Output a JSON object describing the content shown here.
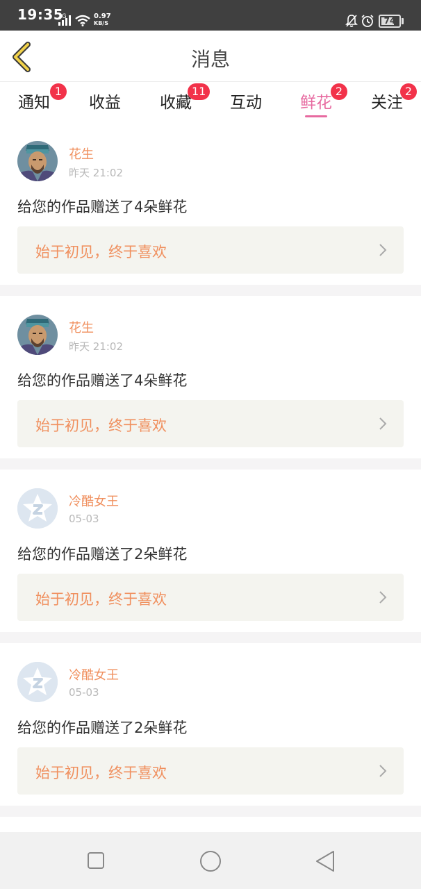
{
  "status_bar": {
    "time": "19:35",
    "network": "2G",
    "speed_value": "0.97",
    "speed_unit": "KB/S",
    "battery": "74",
    "battery_level": 0.74
  },
  "header": {
    "title": "消息",
    "back_icon": "chevron-left-icon"
  },
  "tabs": [
    {
      "label": "通知",
      "badge": "1",
      "active": false
    },
    {
      "label": "收益",
      "badge": "",
      "active": false
    },
    {
      "label": "收藏",
      "badge": "11",
      "active": false
    },
    {
      "label": "互动",
      "badge": "",
      "active": false
    },
    {
      "label": "鲜花",
      "badge": "2",
      "active": true
    },
    {
      "label": "关注",
      "badge": "2",
      "active": false
    }
  ],
  "messages": [
    {
      "user": "花生",
      "time": "昨天 21:02",
      "text": "给您的作品赠送了4朵鲜花",
      "quote": "始于初见，终于喜欢",
      "avatar": "portrait"
    },
    {
      "user": "花生",
      "time": "昨天 21:02",
      "text": "给您的作品赠送了4朵鲜花",
      "quote": "始于初见，终于喜欢",
      "avatar": "portrait"
    },
    {
      "user": "冷酷女王",
      "time": "05-03",
      "text": "给您的作品赠送了2朵鲜花",
      "quote": "始于初见，终于喜欢",
      "avatar": "default"
    },
    {
      "user": "冷酷女王",
      "time": "05-03",
      "text": "给您的作品赠送了2朵鲜花",
      "quote": "始于初见，终于喜欢",
      "avatar": "default"
    }
  ],
  "nav_bar": {
    "buttons": [
      "recent-apps-icon",
      "home-icon",
      "back-triangle-icon"
    ]
  },
  "colors": {
    "accent": "#e76aa0",
    "badge": "#f2324a",
    "username": "#f0905f",
    "status_bar": "#404040"
  }
}
